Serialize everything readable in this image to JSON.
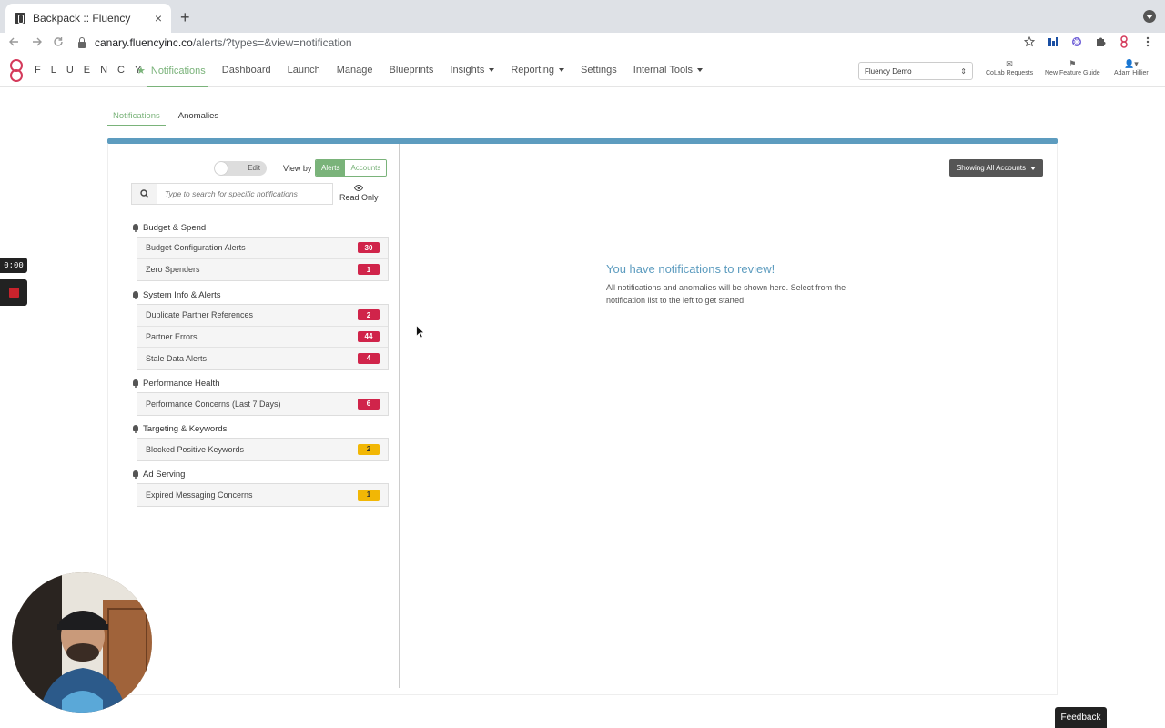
{
  "browser": {
    "tab_title": "Backpack :: Fluency",
    "tab_close": "×",
    "new_tab": "+",
    "url_host": "canary.fluencyinc.co",
    "url_path": "/alerts/?types=&view=notification",
    "icons": [
      "back-icon",
      "forward-icon",
      "reload-icon",
      "lock-icon",
      "bookmark-star-icon",
      "extension-icons",
      "profile-icon"
    ]
  },
  "nav": {
    "brand": "FLUENCY",
    "links": [
      {
        "label": "Notifications",
        "active": true
      },
      {
        "label": "Dashboard"
      },
      {
        "label": "Launch"
      },
      {
        "label": "Manage"
      },
      {
        "label": "Blueprints"
      },
      {
        "label": "Insights",
        "dropdown": true
      },
      {
        "label": "Reporting",
        "dropdown": true
      },
      {
        "label": "Settings"
      },
      {
        "label": "Internal Tools",
        "dropdown": true
      }
    ],
    "account_select": "Fluency Demo",
    "colab": "CoLab Requests",
    "feature_guide": "New Feature Guide",
    "user": "Adam Hillier"
  },
  "subtabs": [
    "Notifications",
    "Anomalies"
  ],
  "controls": {
    "toggle_label": "Edit",
    "view_by_label": "View by",
    "view_alerts": "Alerts",
    "view_accounts": "Accounts",
    "search_placeholder": "Type to search for specific notifications",
    "read_only": "Read Only"
  },
  "groups": [
    {
      "title": "Budget & Spend",
      "items": [
        {
          "label": "Budget Configuration Alerts",
          "count": "30",
          "color": "red"
        },
        {
          "label": "Zero Spenders",
          "count": "1",
          "color": "red"
        }
      ]
    },
    {
      "title": "System Info & Alerts",
      "items": [
        {
          "label": "Duplicate Partner References",
          "count": "2",
          "color": "red"
        },
        {
          "label": "Partner Errors",
          "count": "44",
          "color": "red"
        },
        {
          "label": "Stale Data Alerts",
          "count": "4",
          "color": "red"
        }
      ]
    },
    {
      "title": "Performance Health",
      "items": [
        {
          "label": "Performance Concerns (Last 7 Days)",
          "count": "6",
          "color": "red"
        }
      ]
    },
    {
      "title": "Targeting & Keywords",
      "items": [
        {
          "label": "Blocked Positive Keywords",
          "count": "2",
          "color": "yellow"
        }
      ]
    },
    {
      "title": "Ad Serving",
      "items": [
        {
          "label": "Expired Messaging Concerns",
          "count": "1",
          "color": "yellow"
        }
      ]
    }
  ],
  "right": {
    "showing_button": "Showing All Accounts",
    "empty_title": "You have notifications to review!",
    "empty_text": "All notifications and anomalies will be shown here. Select from the notification list to the left to get started"
  },
  "overlay": {
    "timer": "0:00",
    "feedback": "Feedback"
  },
  "colors": {
    "accent_green": "#7ab37a",
    "accent_blue": "#5d9cbf",
    "badge_red": "#d0244a",
    "badge_yellow": "#f2b705",
    "brand_pink": "#d43a5b"
  }
}
